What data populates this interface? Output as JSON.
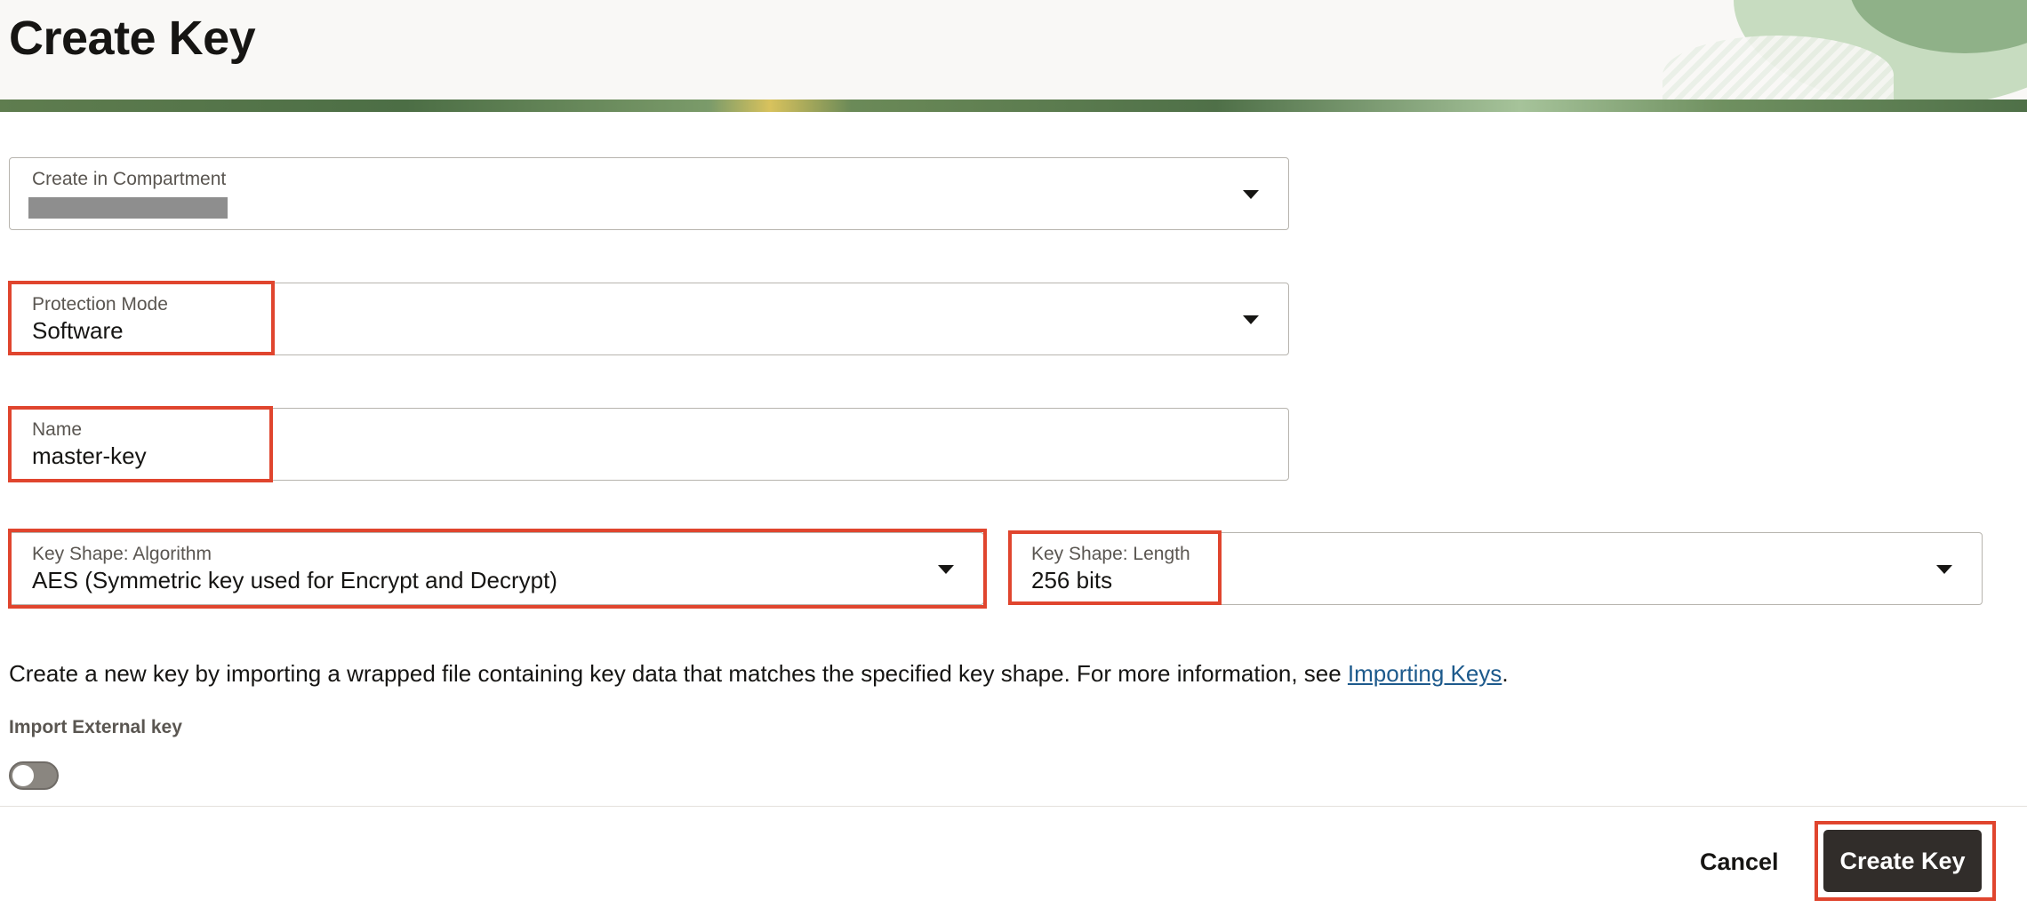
{
  "page": {
    "title": "Create Key"
  },
  "form": {
    "compartment": {
      "label": "Create in Compartment",
      "value": ""
    },
    "protection_mode": {
      "label": "Protection Mode",
      "value": "Software"
    },
    "name": {
      "label": "Name",
      "value": "master-key"
    },
    "key_shape_algorithm": {
      "label": "Key Shape: Algorithm",
      "value": "AES (Symmetric key used for Encrypt and Decrypt)"
    },
    "key_shape_length": {
      "label": "Key Shape: Length",
      "value": "256 bits"
    }
  },
  "info": {
    "text_before": "Create a new key by importing a wrapped file containing key data that matches the specified key shape. For more information, see ",
    "link": "Importing Keys",
    "text_after": "."
  },
  "import_external": {
    "label": "Import External key",
    "enabled": false
  },
  "footer": {
    "cancel_label": "Cancel",
    "create_label": "Create Key"
  },
  "colors": {
    "highlight": "#e0452e",
    "primary_button": "#312d2a",
    "link": "#1d5a8c"
  }
}
